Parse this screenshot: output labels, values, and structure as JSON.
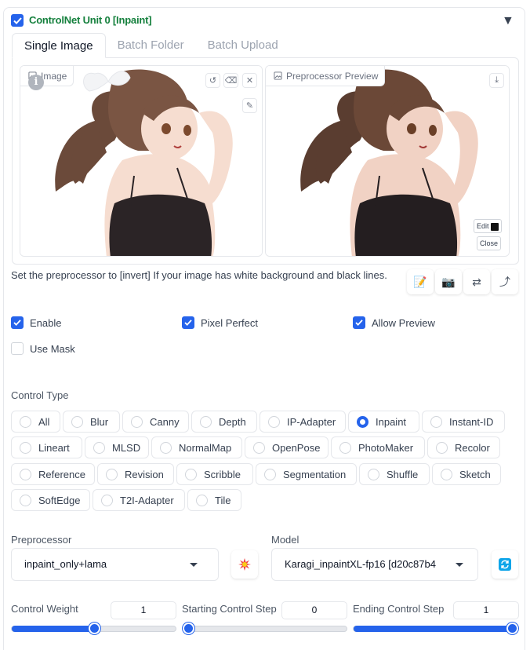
{
  "unit": {
    "title": "ControlNet Unit 0",
    "tag": "[Inpaint]",
    "enabled": true
  },
  "tabs": [
    {
      "label": "Single Image",
      "active": true
    },
    {
      "label": "Batch Folder",
      "active": false
    },
    {
      "label": "Batch Upload",
      "active": false
    }
  ],
  "image_pane": {
    "label": "Image",
    "info_glyph": "i"
  },
  "preview_pane": {
    "label": "Preprocessor Preview",
    "edit_label": "Edit",
    "close_label": "Close"
  },
  "hint": "Set the preprocessor to [invert] If your image has white background and black lines.",
  "checkboxes": [
    {
      "label": "Enable",
      "checked": true
    },
    {
      "label": "Pixel Perfect",
      "checked": true
    },
    {
      "label": "Allow Preview",
      "checked": true
    },
    {
      "label": "Use Mask",
      "checked": false
    }
  ],
  "control_type": {
    "label": "Control Type",
    "selected": "Inpaint",
    "rows": [
      [
        "All",
        "Blur",
        "Canny",
        "Depth",
        "IP-Adapter",
        "Inpaint",
        "Instant-ID"
      ],
      [
        "Lineart",
        "MLSD",
        "NormalMap",
        "OpenPose",
        "PhotoMaker",
        "Recolor"
      ],
      [
        "Reference",
        "Revision",
        "Scribble",
        "Segmentation",
        "Shuffle",
        "Sketch"
      ],
      [
        "SoftEdge",
        "T2I-Adapter",
        "Tile"
      ]
    ]
  },
  "preprocessor": {
    "label": "Preprocessor",
    "value": "inpaint_only+lama"
  },
  "model": {
    "label": "Model",
    "value": "Karagi_inpaintXL-fp16 [d20c87b4"
  },
  "sliders": [
    {
      "label": "Control Weight",
      "value": "1",
      "fraction": 0.5
    },
    {
      "label": "Starting Control Step",
      "value": "0",
      "fraction": 0.0
    },
    {
      "label": "Ending Control Step",
      "value": "1",
      "fraction": 1.0
    }
  ],
  "colors": {
    "accent": "#2563eb",
    "title_green": "#15803d"
  },
  "icons": [
    "chevron-down-icon",
    "image-icon",
    "undo-icon",
    "eraser-icon",
    "close-icon",
    "brush-icon",
    "download-icon",
    "edit-doc-icon",
    "camera-icon",
    "swap-icon",
    "curve-icon",
    "explosion-icon",
    "refresh-icon"
  ]
}
